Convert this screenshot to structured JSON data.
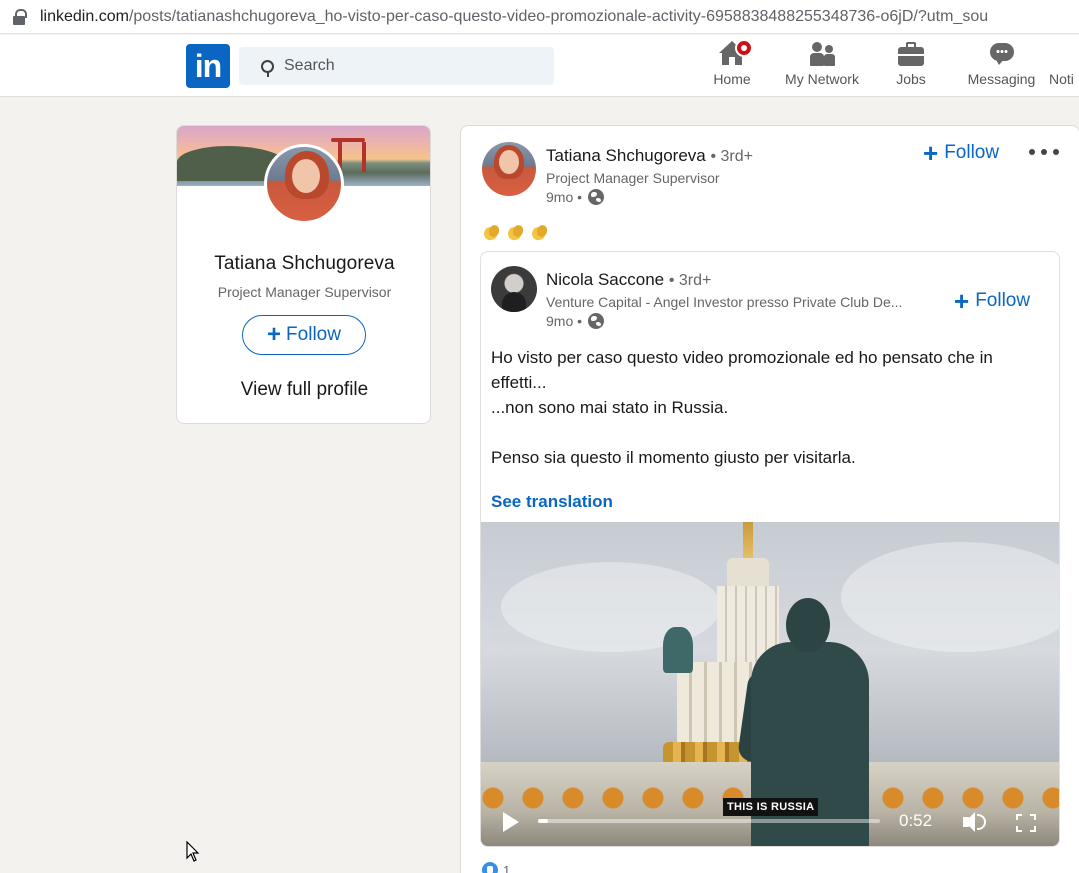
{
  "browser": {
    "url_domain": "linkedin.com",
    "url_path": "/posts/tatianashchugoreva_ho-visto-per-caso-questo-video-promozionale-activity-6958838488255348736-o6jD/?utm_sou"
  },
  "nav": {
    "logo_text": "in",
    "search_placeholder": "Search",
    "items": [
      {
        "label": "Home",
        "icon": "home-icon",
        "badge": true
      },
      {
        "label": "My Network",
        "icon": "network-icon"
      },
      {
        "label": "Jobs",
        "icon": "briefcase-icon"
      },
      {
        "label": "Messaging",
        "icon": "chat-icon"
      },
      {
        "label": "Noti",
        "icon": "bell-icon"
      }
    ]
  },
  "profile_card": {
    "name": "Tatiana Shchugoreva",
    "title": "Project Manager Supervisor",
    "follow_label": "Follow",
    "view_profile_label": "View full profile"
  },
  "post": {
    "author": {
      "name": "Tatiana Shchugoreva",
      "degree": "• 3rd+",
      "title": "Project Manager Supervisor",
      "time": "9mo •"
    },
    "follow_label": "Follow",
    "reshared": {
      "author": {
        "name": "Nicola Saccone",
        "degree": "• 3rd+",
        "title": "Venture Capital - Angel Investor presso Private Club De...",
        "time": "9mo •"
      },
      "follow_label": "Follow",
      "text_lines": [
        "Ho visto per caso questo video promozionale ed ho pensato che in effetti...",
        "...non sono mai stato in Russia.",
        "",
        "Penso sia questo il momento giusto per visitarla."
      ],
      "see_translation": "See translation",
      "video": {
        "caption": "THIS IS RUSSIA",
        "time": "0:52",
        "progress": 0.03
      }
    },
    "reactions_count": "1"
  },
  "colors": {
    "brand_blue": "#0a66c2",
    "notification_red": "#cc1016",
    "page_bg": "#f3f2ef"
  }
}
